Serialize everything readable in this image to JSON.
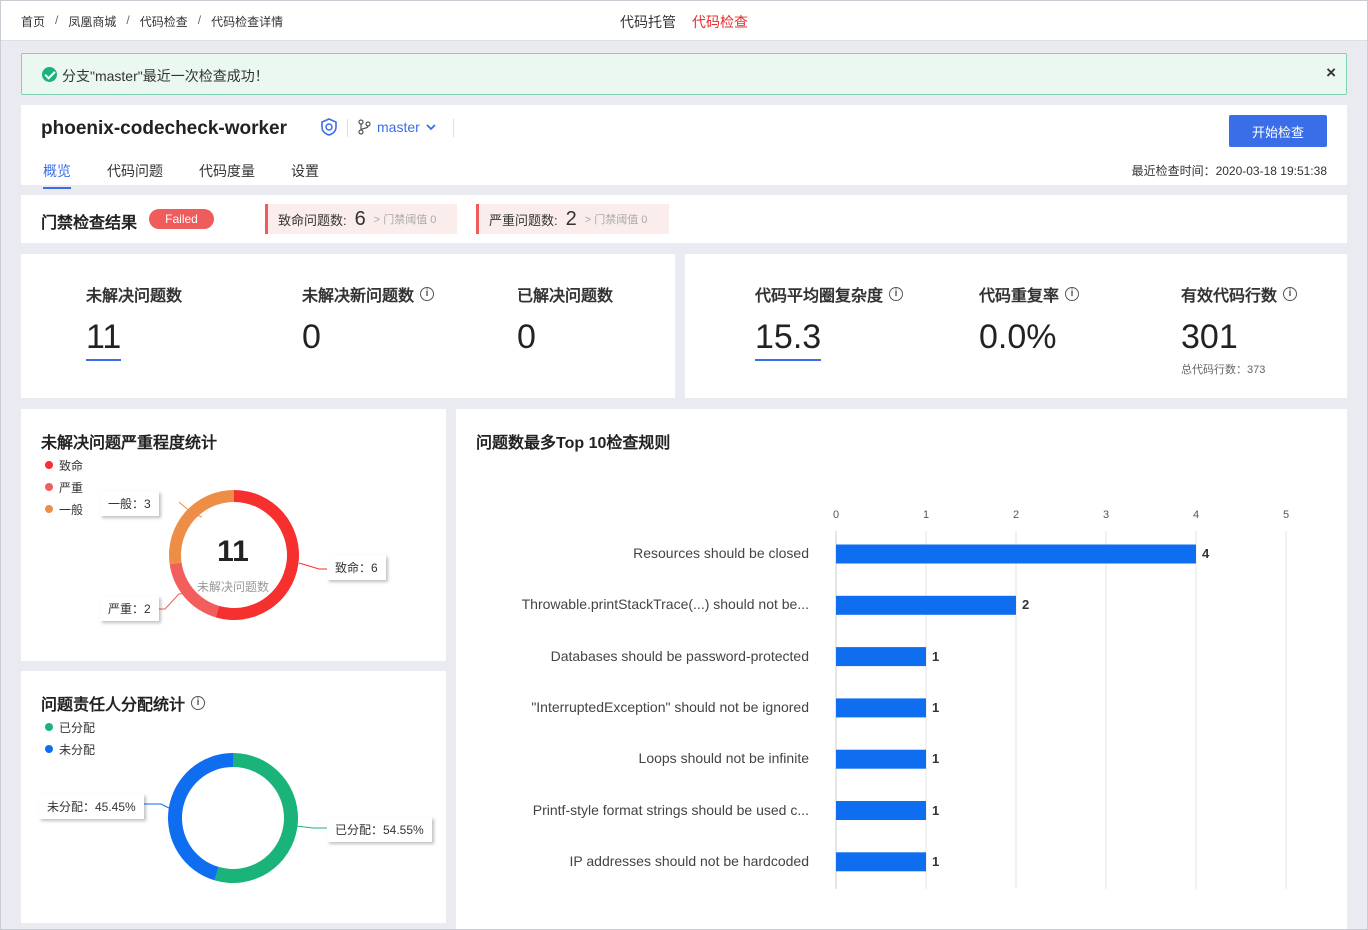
{
  "breadcrumb": [
    "首页",
    "凤凰商城",
    "代码检查",
    "代码检查详情"
  ],
  "breadcrumb_sep": "/",
  "topnav": [
    {
      "label": "代码托管"
    },
    {
      "label": "代码检查",
      "active": true
    }
  ],
  "alert": {
    "message": "分支\"master\"最近一次检查成功！",
    "close": "×"
  },
  "project": {
    "name": "phoenix-codecheck-worker",
    "branch": "master",
    "start_button": "开始检查"
  },
  "tabs": [
    {
      "label": "概览",
      "active": true
    },
    {
      "label": "代码问题"
    },
    {
      "label": "代码度量"
    },
    {
      "label": "设置"
    }
  ],
  "last_check": "最近检查时间：2020-03-18 19:51:38",
  "gate": {
    "title": "门禁检查结果",
    "status": "Failed",
    "fatal": {
      "label": "致命问题数:",
      "value": "6",
      "threshold": "> 门禁阈值 0"
    },
    "serious": {
      "label": "严重问题数:",
      "value": "2",
      "threshold": "> 门禁阈值 0"
    }
  },
  "stats_left": [
    {
      "label": "未解决问题数",
      "value": "11"
    },
    {
      "label": "未解决新问题数",
      "value": "0"
    },
    {
      "label": "已解决问题数",
      "value": "0"
    }
  ],
  "stats_right": [
    {
      "label": "代码平均圈复杂度",
      "value": "15.3"
    },
    {
      "label": "代码重复率",
      "value": "0.0%"
    },
    {
      "label": "有效代码行数",
      "value": "301",
      "sub": "总代码行数：373"
    }
  ],
  "severity_panel": {
    "title": "未解决问题严重程度统计",
    "legend": [
      "致命",
      "严重",
      "一般"
    ],
    "colors": [
      "#f5302f",
      "#f25d5d",
      "#ee8e46"
    ],
    "total": "11",
    "total_label": "未解决问题数",
    "callouts": {
      "fatal": "致命：6",
      "serious": "严重：2",
      "general": "一般：3"
    }
  },
  "assign_panel": {
    "title": "问题责任人分配统计",
    "legend": [
      "已分配",
      "未分配"
    ],
    "colors": [
      "#1ab37a",
      "#0f6ef0"
    ],
    "callouts": {
      "assigned": "已分配：54.55%",
      "unassigned": "未分配：45.45%"
    }
  },
  "top10_panel": {
    "title": "问题数最多Top 10检查规则"
  },
  "chart_data": [
    {
      "type": "pie",
      "title": "未解决问题严重程度统计",
      "categories": [
        "致命",
        "严重",
        "一般"
      ],
      "values": [
        6,
        2,
        3
      ]
    },
    {
      "type": "pie",
      "title": "问题责任人分配统计",
      "categories": [
        "已分配",
        "未分配"
      ],
      "values": [
        54.55,
        45.45
      ]
    },
    {
      "type": "bar",
      "orientation": "horizontal",
      "title": "问题数最多Top 10检查规则",
      "categories": [
        "Resources should be closed",
        "Throwable.printStackTrace(...) should not be...",
        "Databases should be password-protected",
        "\"InterruptedException\" should not be ignored",
        "Loops should not be infinite",
        "Printf-style format strings should be used c...",
        "IP addresses should not be hardcoded"
      ],
      "values": [
        4,
        2,
        1,
        1,
        1,
        1,
        1
      ],
      "xlim": [
        0,
        5
      ],
      "xticks": [
        0,
        1,
        2,
        3,
        4,
        5
      ],
      "grid": true,
      "color": "#0f6ef0"
    }
  ]
}
